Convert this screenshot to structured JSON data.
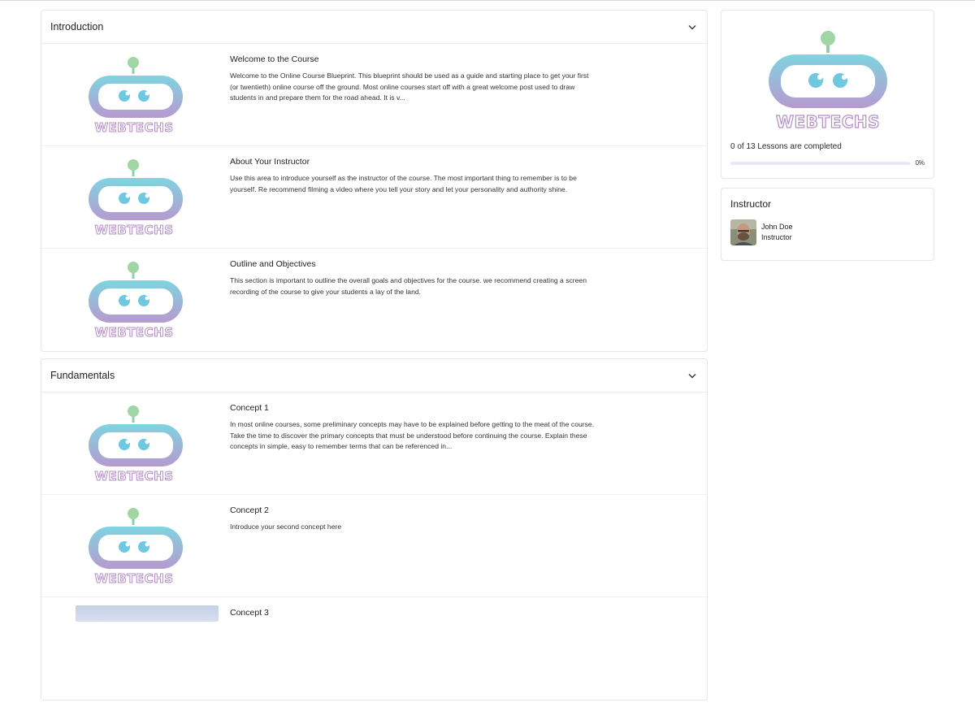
{
  "sections": [
    {
      "title": "Introduction",
      "lessons": [
        {
          "title": "Welcome to the Course",
          "description": "Welcome to the Online Course Blueprint. This blueprint should be used as a guide and starting place to get your first (or twentieth) online course off the ground. Most online courses start off with a great welcome post used to draw students in and prepare them for the road ahead. It is v..."
        },
        {
          "title": "About Your Instructor",
          "description": "Use this area to introduce yourself as the instructor of the course. The most important thing to remember is to be yourself. Re recommend filming a video where you tell your story and let your personality and authority shine."
        },
        {
          "title": "Outline and Objectives",
          "description": "This section is important to outline the overall goals and objectives for the course. we recommend creating a screen recording of the course to give your students a lay of the land."
        }
      ]
    },
    {
      "title": "Fundamentals",
      "lessons": [
        {
          "title": "Concept 1",
          "description": "In most online courses, some preliminary concepts may have to be explained before getting to the meat of the course. Take the time to discover the primary concepts that must be understood before continuing the course. Explain these concepts in simple, easy to remember terms that can be referenced in..."
        },
        {
          "title": "Concept 2",
          "description": "Introduce your second concept here"
        },
        {
          "title": "Concept 3",
          "description": ""
        }
      ]
    }
  ],
  "logo": {
    "wordmark": "WEBTECHS",
    "icon": "robot-logo-icon"
  },
  "progress": {
    "text": "0 of 13 Lessons are completed",
    "percent_label": "0%",
    "percent": 0
  },
  "instructor": {
    "heading": "Instructor",
    "name": "John Doe",
    "role": "Instructor"
  },
  "colors": {
    "accent": "#6a74e8",
    "logo_teal": "#7fd0dc",
    "logo_purple": "#b79ad0",
    "logo_green": "#9fd6a4"
  }
}
